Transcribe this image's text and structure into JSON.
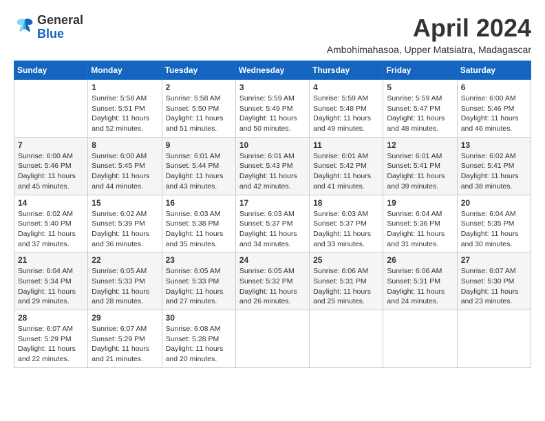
{
  "header": {
    "logo_line1": "General",
    "logo_line2": "Blue",
    "month_title": "April 2024",
    "subtitle": "Ambohimahasoa, Upper Matsiatra, Madagascar"
  },
  "calendar": {
    "days_of_week": [
      "Sunday",
      "Monday",
      "Tuesday",
      "Wednesday",
      "Thursday",
      "Friday",
      "Saturday"
    ],
    "weeks": [
      [
        {
          "day": "",
          "info": ""
        },
        {
          "day": "1",
          "info": "Sunrise: 5:58 AM\nSunset: 5:51 PM\nDaylight: 11 hours\nand 52 minutes."
        },
        {
          "day": "2",
          "info": "Sunrise: 5:58 AM\nSunset: 5:50 PM\nDaylight: 11 hours\nand 51 minutes."
        },
        {
          "day": "3",
          "info": "Sunrise: 5:59 AM\nSunset: 5:49 PM\nDaylight: 11 hours\nand 50 minutes."
        },
        {
          "day": "4",
          "info": "Sunrise: 5:59 AM\nSunset: 5:48 PM\nDaylight: 11 hours\nand 49 minutes."
        },
        {
          "day": "5",
          "info": "Sunrise: 5:59 AM\nSunset: 5:47 PM\nDaylight: 11 hours\nand 48 minutes."
        },
        {
          "day": "6",
          "info": "Sunrise: 6:00 AM\nSunset: 5:46 PM\nDaylight: 11 hours\nand 46 minutes."
        }
      ],
      [
        {
          "day": "7",
          "info": "Sunrise: 6:00 AM\nSunset: 5:46 PM\nDaylight: 11 hours\nand 45 minutes."
        },
        {
          "day": "8",
          "info": "Sunrise: 6:00 AM\nSunset: 5:45 PM\nDaylight: 11 hours\nand 44 minutes."
        },
        {
          "day": "9",
          "info": "Sunrise: 6:01 AM\nSunset: 5:44 PM\nDaylight: 11 hours\nand 43 minutes."
        },
        {
          "day": "10",
          "info": "Sunrise: 6:01 AM\nSunset: 5:43 PM\nDaylight: 11 hours\nand 42 minutes."
        },
        {
          "day": "11",
          "info": "Sunrise: 6:01 AM\nSunset: 5:42 PM\nDaylight: 11 hours\nand 41 minutes."
        },
        {
          "day": "12",
          "info": "Sunrise: 6:01 AM\nSunset: 5:41 PM\nDaylight: 11 hours\nand 39 minutes."
        },
        {
          "day": "13",
          "info": "Sunrise: 6:02 AM\nSunset: 5:41 PM\nDaylight: 11 hours\nand 38 minutes."
        }
      ],
      [
        {
          "day": "14",
          "info": "Sunrise: 6:02 AM\nSunset: 5:40 PM\nDaylight: 11 hours\nand 37 minutes."
        },
        {
          "day": "15",
          "info": "Sunrise: 6:02 AM\nSunset: 5:39 PM\nDaylight: 11 hours\nand 36 minutes."
        },
        {
          "day": "16",
          "info": "Sunrise: 6:03 AM\nSunset: 5:38 PM\nDaylight: 11 hours\nand 35 minutes."
        },
        {
          "day": "17",
          "info": "Sunrise: 6:03 AM\nSunset: 5:37 PM\nDaylight: 11 hours\nand 34 minutes."
        },
        {
          "day": "18",
          "info": "Sunrise: 6:03 AM\nSunset: 5:37 PM\nDaylight: 11 hours\nand 33 minutes."
        },
        {
          "day": "19",
          "info": "Sunrise: 6:04 AM\nSunset: 5:36 PM\nDaylight: 11 hours\nand 31 minutes."
        },
        {
          "day": "20",
          "info": "Sunrise: 6:04 AM\nSunset: 5:35 PM\nDaylight: 11 hours\nand 30 minutes."
        }
      ],
      [
        {
          "day": "21",
          "info": "Sunrise: 6:04 AM\nSunset: 5:34 PM\nDaylight: 11 hours\nand 29 minutes."
        },
        {
          "day": "22",
          "info": "Sunrise: 6:05 AM\nSunset: 5:33 PM\nDaylight: 11 hours\nand 28 minutes."
        },
        {
          "day": "23",
          "info": "Sunrise: 6:05 AM\nSunset: 5:33 PM\nDaylight: 11 hours\nand 27 minutes."
        },
        {
          "day": "24",
          "info": "Sunrise: 6:05 AM\nSunset: 5:32 PM\nDaylight: 11 hours\nand 26 minutes."
        },
        {
          "day": "25",
          "info": "Sunrise: 6:06 AM\nSunset: 5:31 PM\nDaylight: 11 hours\nand 25 minutes."
        },
        {
          "day": "26",
          "info": "Sunrise: 6:06 AM\nSunset: 5:31 PM\nDaylight: 11 hours\nand 24 minutes."
        },
        {
          "day": "27",
          "info": "Sunrise: 6:07 AM\nSunset: 5:30 PM\nDaylight: 11 hours\nand 23 minutes."
        }
      ],
      [
        {
          "day": "28",
          "info": "Sunrise: 6:07 AM\nSunset: 5:29 PM\nDaylight: 11 hours\nand 22 minutes."
        },
        {
          "day": "29",
          "info": "Sunrise: 6:07 AM\nSunset: 5:29 PM\nDaylight: 11 hours\nand 21 minutes."
        },
        {
          "day": "30",
          "info": "Sunrise: 6:08 AM\nSunset: 5:28 PM\nDaylight: 11 hours\nand 20 minutes."
        },
        {
          "day": "",
          "info": ""
        },
        {
          "day": "",
          "info": ""
        },
        {
          "day": "",
          "info": ""
        },
        {
          "day": "",
          "info": ""
        }
      ]
    ]
  }
}
